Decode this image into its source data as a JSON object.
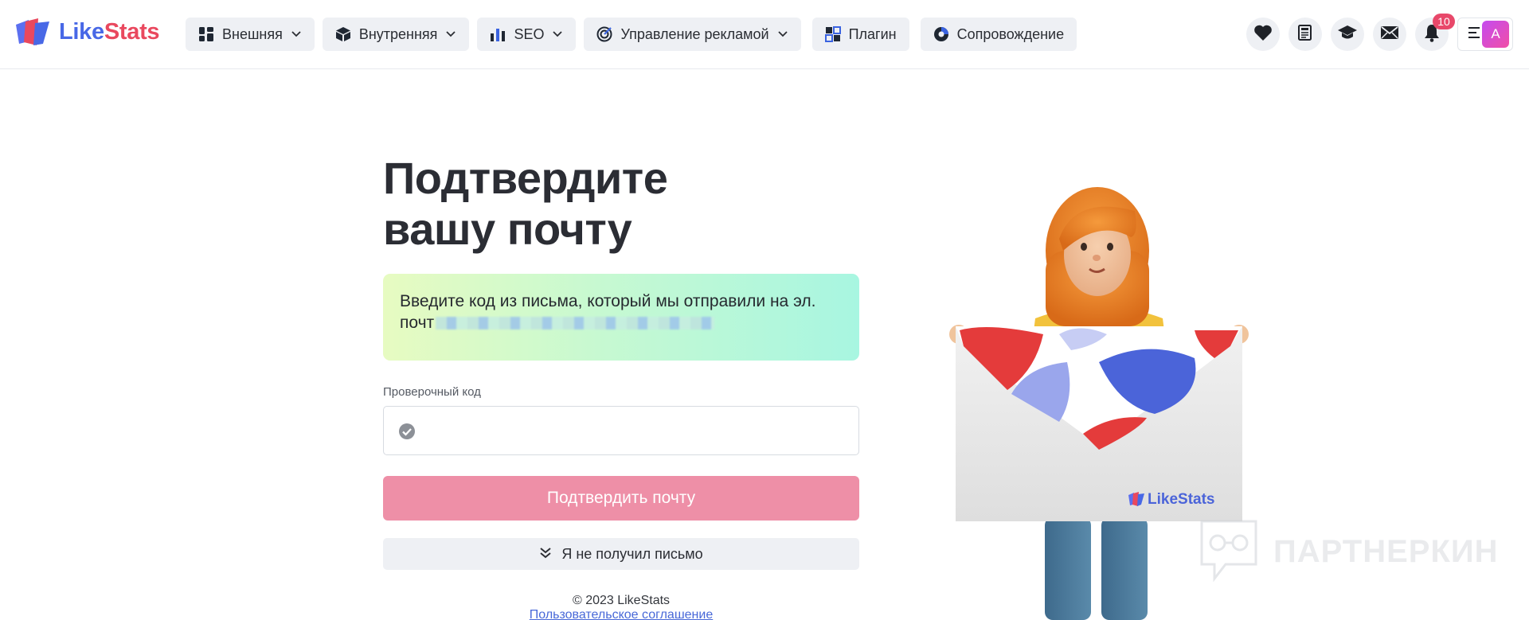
{
  "brand": {
    "name_part1": "Like",
    "name_part2": "Stats",
    "color_blue": "#4868e6",
    "color_red": "#e9485e"
  },
  "nav": [
    {
      "label": "Внешняя",
      "icon": "grid-icon",
      "has_dropdown": true
    },
    {
      "label": "Внутренняя",
      "icon": "cube-icon",
      "has_dropdown": true
    },
    {
      "label": "SEO",
      "icon": "bar-chart-icon",
      "has_dropdown": true
    },
    {
      "label": "Управление рекламой",
      "icon": "target-icon",
      "has_dropdown": true
    },
    {
      "label": "Плагин",
      "icon": "puzzle-icon",
      "has_dropdown": false
    },
    {
      "label": "Сопровождение",
      "icon": "support-icon",
      "has_dropdown": false
    }
  ],
  "header_icons": {
    "favorites": "heart-icon",
    "docs": "book-icon",
    "learning": "graduation-cap-icon",
    "messages": "envelope-icon",
    "notifications": "bell-icon",
    "notifications_count": "10",
    "menu": "hamburger-icon",
    "avatar_letter": "A"
  },
  "page": {
    "title_line1": "Подтвердите",
    "title_line2": "вашу почту",
    "info_text": "Введите код из письма, который мы отправили на эл. почт",
    "code_label": "Проверочный код",
    "code_value": "",
    "confirm_button": "Подтвердить почту",
    "no_mail_button": "Я не получил письмо",
    "copyright": "© 2023 LikeStats",
    "agreement_link": "Пользовательское соглашение",
    "accent_pink": "#ee8fa7"
  },
  "illustration": {
    "envelope_brand": "LikeStats"
  },
  "watermark": {
    "text": "ПАРТНЕРКИН"
  }
}
